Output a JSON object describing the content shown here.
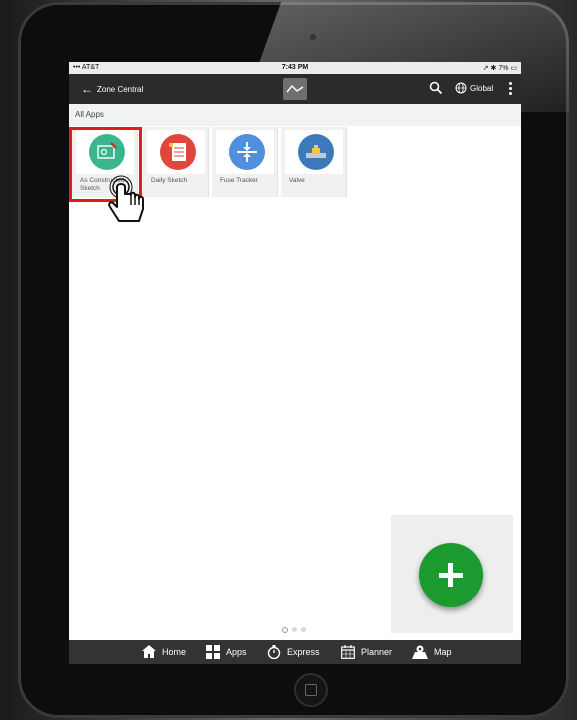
{
  "status_bar": {
    "carrier": "••• AT&T",
    "time": "7:43 PM",
    "battery": "7%"
  },
  "nav": {
    "back_label": "Zone Central",
    "global_label": "Global"
  },
  "section": {
    "title": "All Apps"
  },
  "apps": [
    {
      "label": "As Constructed Sketch",
      "color": "#3bb58e",
      "icon": "map-sketch-icon"
    },
    {
      "label": "Daily Sketch",
      "color": "#e0473c",
      "icon": "daily-sketch-icon"
    },
    {
      "label": "Fuse Tracker",
      "color": "#4f8fdb",
      "icon": "fuse-icon"
    },
    {
      "label": "Valve",
      "color": "#3c79b8",
      "icon": "valve-icon"
    }
  ],
  "tab_bar": {
    "items": [
      {
        "label": "Home",
        "icon": "home-icon"
      },
      {
        "label": "Apps",
        "icon": "apps-grid-icon"
      },
      {
        "label": "Express",
        "icon": "stopwatch-icon"
      },
      {
        "label": "Planner",
        "icon": "calendar-icon"
      },
      {
        "label": "Map",
        "icon": "map-pin-icon"
      }
    ]
  },
  "colors": {
    "fab": "#1a9a2f",
    "highlight": "#e21b1b",
    "nav_bg": "#2b2b2b"
  }
}
